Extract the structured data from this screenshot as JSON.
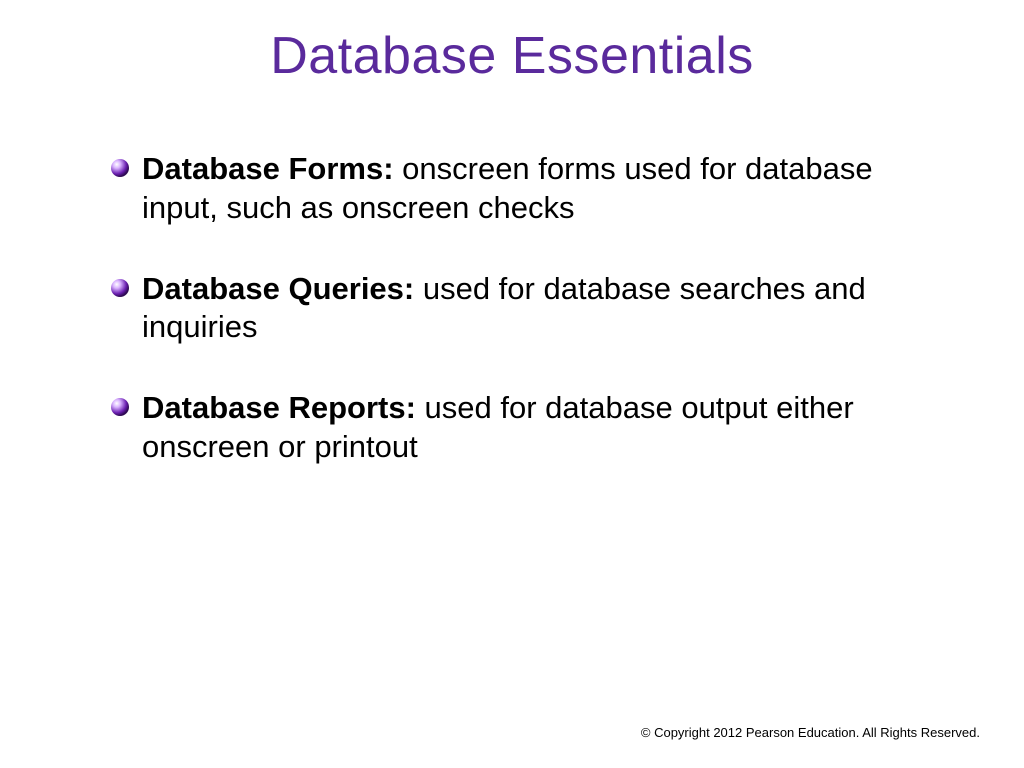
{
  "title": "Database Essentials",
  "bullets": [
    {
      "term": "Database Forms:",
      "definition": " onscreen forms used for database input, such as onscreen checks"
    },
    {
      "term": "Database Queries:",
      "definition": " used for database searches and inquiries"
    },
    {
      "term": "Database Reports:",
      "definition": " used for database output either onscreen or printout"
    }
  ],
  "copyright": "© Copyright 2012 Pearson Education. All Rights Reserved."
}
